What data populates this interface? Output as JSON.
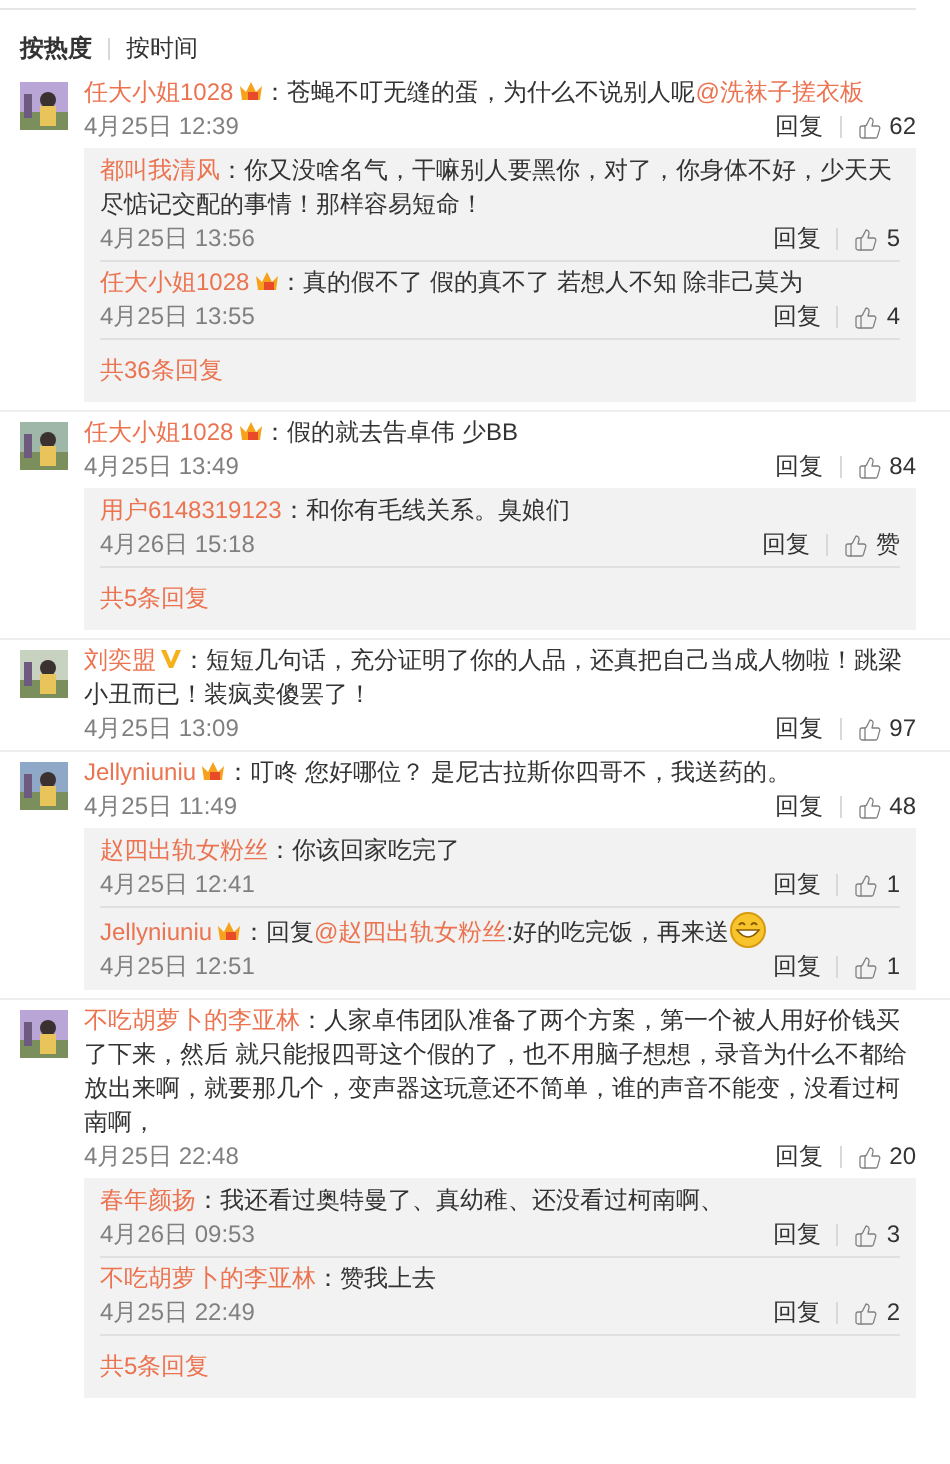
{
  "sort_tabs": [
    {
      "label": "按热度",
      "selected": true
    },
    {
      "label": "按时间",
      "selected": false
    }
  ],
  "comments": [
    {
      "user": "任大小姐1028",
      "badge": {
        "kind": "vip"
      },
      "segments": [
        {
          "kind": "text",
          "text": "：苍蝇不叮无缝的蛋，为什么不说别人呢"
        },
        {
          "kind": "mention",
          "text": "@洗袜子搓衣板"
        }
      ],
      "time": "4月25日 12:39",
      "reply_label": "回复",
      "likes": "62",
      "replies": [
        {
          "user": "都叫我清风",
          "segments": [
            {
              "kind": "text",
              "text": "：你又没啥名气，干嘛别人要黑你，对了，你身体不好，少天天尽惦记交配的事情！那样容易短命！"
            }
          ],
          "time": "4月25日 13:56",
          "reply_label": "回复",
          "likes": "5"
        },
        {
          "user": "任大小姐1028",
          "badge": {
            "kind": "vip"
          },
          "segments": [
            {
              "kind": "text",
              "text": "：真的假不了 假的真不了 若想人不知 除非己莫为"
            }
          ],
          "time": "4月25日 13:55",
          "reply_label": "回复",
          "likes": "4"
        }
      ],
      "more": "共36条回复"
    },
    {
      "user": "任大小姐1028",
      "badge": {
        "kind": "vip"
      },
      "segments": [
        {
          "kind": "text",
          "text": "：假的就去告卓伟 少BB"
        }
      ],
      "time": "4月25日 13:49",
      "reply_label": "回复",
      "likes": "84",
      "replies": [
        {
          "user": "用户6148319123",
          "segments": [
            {
              "kind": "text",
              "text": "：和你有毛线关系。臭娘们"
            }
          ],
          "time": "4月26日 15:18",
          "reply_label": "回复",
          "likes": "赞"
        }
      ],
      "more": "共5条回复"
    },
    {
      "user": "刘奕盟",
      "badge": {
        "kind": "verified"
      },
      "segments": [
        {
          "kind": "text",
          "text": "：短短几句话，充分证明了你的人品，还真把自己当成人物啦！跳梁小丑而已！装疯卖傻罢了！"
        }
      ],
      "time": "4月25日 13:09",
      "reply_label": "回复",
      "likes": "97"
    },
    {
      "user": "Jellyniuniu",
      "badge": {
        "kind": "vip"
      },
      "segments": [
        {
          "kind": "text",
          "text": "：叮咚 您好哪位？ 是尼古拉斯你四哥不，我送药的。"
        }
      ],
      "time": "4月25日 11:49",
      "reply_label": "回复",
      "likes": "48",
      "replies": [
        {
          "user": "赵四出轨女粉丝",
          "segments": [
            {
              "kind": "text",
              "text": "：你该回家吃完了"
            }
          ],
          "time": "4月25日 12:41",
          "reply_label": "回复",
          "likes": "1"
        },
        {
          "user": "Jellyniuniu",
          "badge": {
            "kind": "vip"
          },
          "segments": [
            {
              "kind": "text",
              "text": "：回复"
            },
            {
              "kind": "mention",
              "text": "@赵四出轨女粉丝"
            },
            {
              "kind": "text",
              "text": ":好的吃完饭，再来送"
            },
            {
              "kind": "emoji"
            }
          ],
          "time": "4月25日 12:51",
          "reply_label": "回复",
          "likes": "1"
        }
      ]
    },
    {
      "user": "不吃胡萝卜的李亚林",
      "segments": [
        {
          "kind": "text",
          "text": "：人家卓伟团队准备了两个方案，第一个被人用好价钱买了下来，然后 就只能报四哥这个假的了，也不用脑子想想，录音为什么不都给放出来啊，就要那几个，变声器这玩意还不简单，谁的声音不能变，没看过柯南啊，"
        }
      ],
      "time": "4月25日 22:48",
      "reply_label": "回复",
      "likes": "20",
      "replies": [
        {
          "user": "春年颜扬",
          "segments": [
            {
              "kind": "text",
              "text": "：我还看过奥特曼了、真幼稚、还没看过柯南啊、"
            }
          ],
          "time": "4月26日 09:53",
          "reply_label": "回复",
          "likes": "3"
        },
        {
          "user": "不吃胡萝卜的李亚林",
          "segments": [
            {
              "kind": "text",
              "text": "：赞我上去"
            }
          ],
          "time": "4月25日 22:49",
          "reply_label": "回复",
          "likes": "2"
        }
      ],
      "more": "共5条回复"
    }
  ]
}
